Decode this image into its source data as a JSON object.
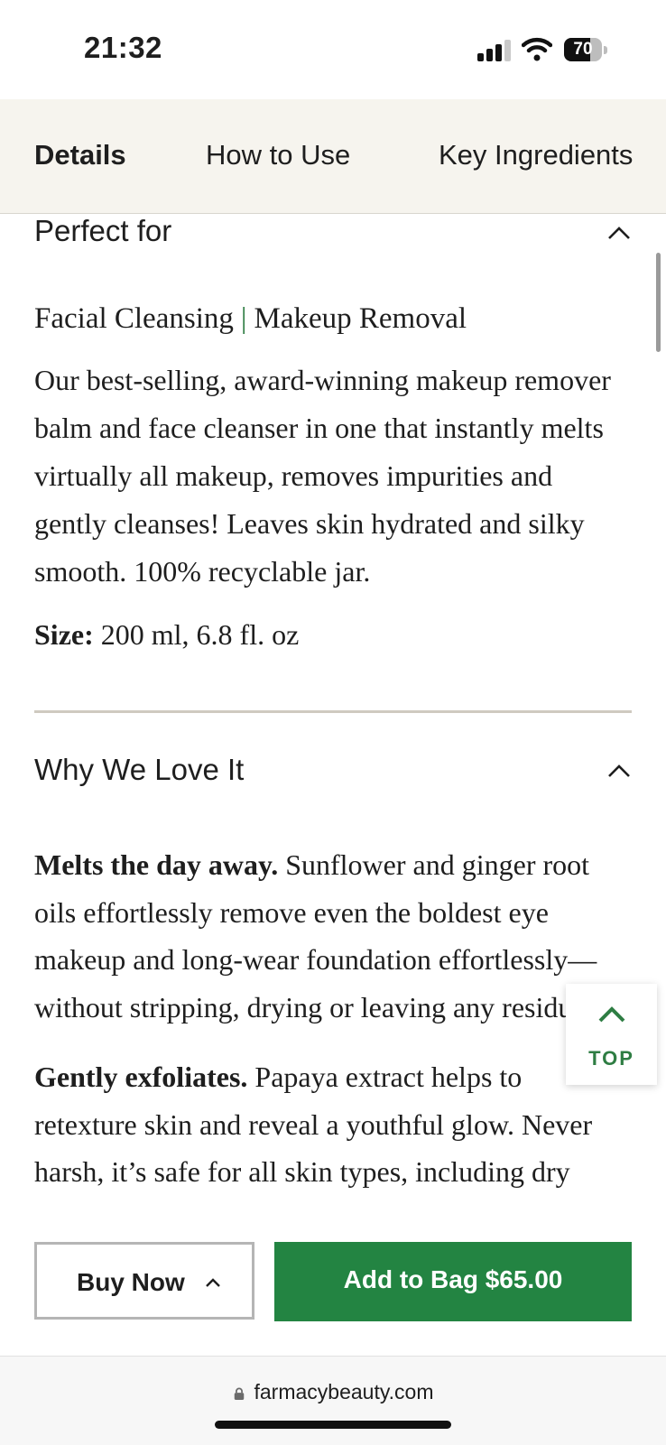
{
  "status": {
    "time": "21:32",
    "battery": "70",
    "battery_level": 0.7
  },
  "tabs": [
    {
      "label": "Details",
      "active": true
    },
    {
      "label": "How to Use",
      "active": false
    },
    {
      "label": "Key Ingredients",
      "active": false
    }
  ],
  "sections": {
    "perfect_for": {
      "title": "Perfect for",
      "tag1": "Facial Cleansing",
      "tag_separator": "|",
      "tag2": "Makeup Removal",
      "description": "Our best-selling, award-winning makeup remover balm and face cleanser in one that instantly melts virtually all makeup, removes impurities and gently cleanses! Leaves skin hydrated and silky smooth. 100% recyclable jar.",
      "size_label": "Size:",
      "size_value": "200 ml, 6.8 fl. oz"
    },
    "why_we_love_it": {
      "title": "Why We Love It",
      "p1_bold": "Melts the day away.",
      "p1_text": "Sunflower and ginger root oils effortlessly remove even the boldest eye makeup and long-wear foundation effortlessly—without stripping, drying or leaving any residue.",
      "p2_bold": "Gently exfoliates.",
      "p2_text": "Papaya extract helps to retexture skin and reveal a youthful glow. Never harsh, it’s safe for all skin types, including dry"
    }
  },
  "scroll_top": {
    "label": "TOP"
  },
  "actions": {
    "buy_now": "Buy Now",
    "add_to_bag": "Add to Bag $65.00"
  },
  "browser": {
    "url": "farmacybeauty.com"
  },
  "colors": {
    "accent_green": "#238442",
    "tab_bg": "#f6f4ee",
    "divider": "#cfcac0"
  },
  "icons": [
    "signal-icon",
    "wifi-icon",
    "battery-icon",
    "chevron-up-icon",
    "lock-icon"
  ]
}
